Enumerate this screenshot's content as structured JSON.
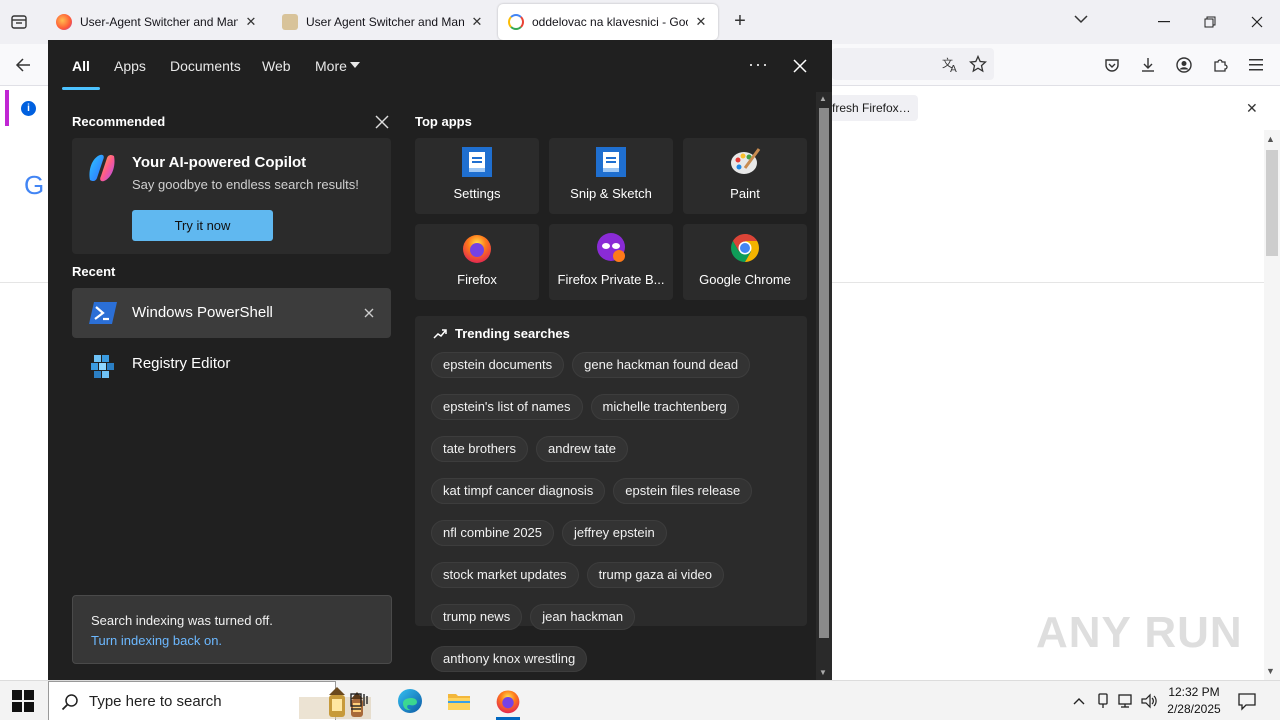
{
  "browser": {
    "tabs": [
      {
        "title": "User-Agent Switcher and Manager",
        "favicon": "firefox-icon",
        "active": false
      },
      {
        "title": "User Agent Switcher and Manager",
        "favicon": "extension-icon",
        "active": false
      },
      {
        "title": "oddelovac na klavesnici - Google",
        "favicon": "google-icon",
        "active": true
      }
    ],
    "notification": {
      "action_label": "fresh Firefox…"
    },
    "page_logo_letter": "G",
    "watermark": "ANY RUN"
  },
  "search_panel": {
    "tabs": [
      "All",
      "Apps",
      "Documents",
      "Web",
      "More"
    ],
    "active_tab": "All",
    "recommended": {
      "title": "Recommended",
      "card_title": "Your AI-powered Copilot",
      "card_subtitle": "Say goodbye to endless search results!",
      "card_button": "Try it now"
    },
    "recent": {
      "title": "Recent",
      "items": [
        {
          "label": "Windows PowerShell",
          "icon": "powershell-icon"
        },
        {
          "label": "Registry Editor",
          "icon": "registry-editor-icon"
        }
      ]
    },
    "indexing": {
      "message": "Search indexing was turned off.",
      "link": "Turn indexing back on."
    },
    "top_apps": {
      "title": "Top apps",
      "apps": [
        {
          "label": "Settings",
          "icon": "settings-app-icon"
        },
        {
          "label": "Snip & Sketch",
          "icon": "snip-sketch-icon"
        },
        {
          "label": "Paint",
          "icon": "paint-icon"
        },
        {
          "label": "Firefox",
          "icon": "firefox-icon"
        },
        {
          "label": "Firefox Private B...",
          "icon": "firefox-private-icon"
        },
        {
          "label": "Google Chrome",
          "icon": "chrome-icon"
        }
      ]
    },
    "trending": {
      "title": "Trending searches",
      "rows": [
        [
          "epstein documents",
          "gene hackman found dead"
        ],
        [
          "epstein's list of names",
          "michelle trachtenberg"
        ],
        [
          "tate brothers",
          "andrew tate"
        ],
        [
          "kat timpf cancer diagnosis",
          "epstein files release"
        ],
        [
          "nfl combine 2025",
          "jeffrey epstein"
        ],
        [
          "stock market updates",
          "trump gaza ai video"
        ],
        [
          "trump news",
          "jean hackman"
        ],
        [
          "anthony knox wrestling"
        ]
      ]
    }
  },
  "taskbar": {
    "search_placeholder": "Type here to search",
    "time": "12:32 PM",
    "date": "2/28/2025"
  },
  "colors": {
    "panel_bg": "#202020",
    "tile_bg": "#2b2b2b",
    "accent": "#4cc2ff",
    "button": "#60b8f0"
  }
}
